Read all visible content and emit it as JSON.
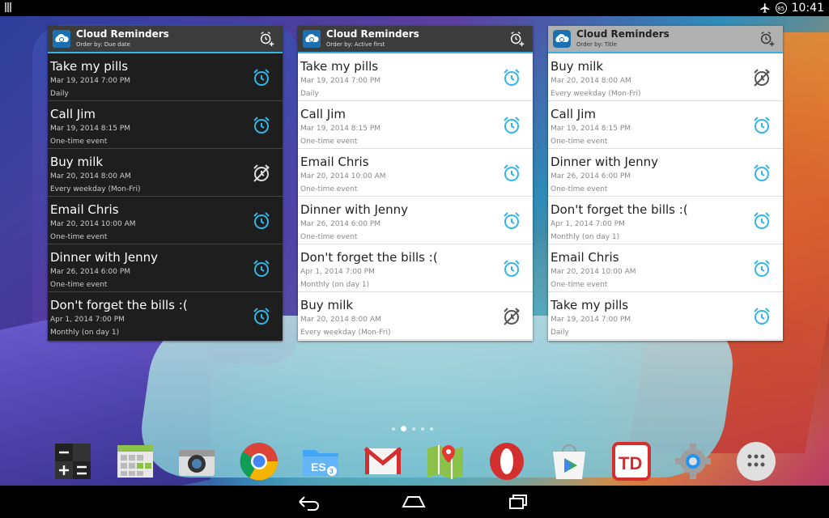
{
  "status_bar": {
    "time": "10:41",
    "battery": "85"
  },
  "widgets": [
    {
      "title": "Cloud Reminders",
      "order": "Order by: Due date",
      "items": [
        {
          "title": "Take my pills",
          "date": "Mar 19, 2014 7:00 PM",
          "repeat": "Daily",
          "alarm": "on"
        },
        {
          "title": "Call Jim",
          "date": "Mar 19, 2014 8:15 PM",
          "repeat": "One-time event",
          "alarm": "on"
        },
        {
          "title": "Buy milk",
          "date": "Mar 20, 2014 8:00 AM",
          "repeat": "Every weekday (Mon-Fri)",
          "alarm": "off"
        },
        {
          "title": "Email Chris",
          "date": "Mar 20, 2014 10:00 AM",
          "repeat": "One-time event",
          "alarm": "on"
        },
        {
          "title": "Dinner with Jenny",
          "date": "Mar 26, 2014 6:00 PM",
          "repeat": "One-time event",
          "alarm": "on"
        },
        {
          "title": "Don't forget the bills :(",
          "date": "Apr 1, 2014 7:00 PM",
          "repeat": "Monthly (on day 1)",
          "alarm": "on"
        }
      ]
    },
    {
      "title": "Cloud Reminders",
      "order": "Order by: Active first",
      "items": [
        {
          "title": "Take my pills",
          "date": "Mar 19, 2014 7:00 PM",
          "repeat": "Daily",
          "alarm": "on"
        },
        {
          "title": "Call Jim",
          "date": "Mar 19, 2014 8:15 PM",
          "repeat": "One-time event",
          "alarm": "on"
        },
        {
          "title": "Email Chris",
          "date": "Mar 20, 2014 10:00 AM",
          "repeat": "One-time event",
          "alarm": "on"
        },
        {
          "title": "Dinner with Jenny",
          "date": "Mar 26, 2014 6:00 PM",
          "repeat": "One-time event",
          "alarm": "on"
        },
        {
          "title": "Don't forget the bills :(",
          "date": "Apr 1, 2014 7:00 PM",
          "repeat": "Monthly (on day 1)",
          "alarm": "on"
        },
        {
          "title": "Buy milk",
          "date": "Mar 20, 2014 8:00 AM",
          "repeat": "Every weekday (Mon-Fri)",
          "alarm": "off"
        }
      ]
    },
    {
      "title": "Cloud Reminders",
      "order": "Order by: Title",
      "items": [
        {
          "title": "Buy milk",
          "date": "Mar 20, 2014 8:00 AM",
          "repeat": "Every weekday (Mon-Fri)",
          "alarm": "off"
        },
        {
          "title": "Call Jim",
          "date": "Mar 19, 2014 8:15 PM",
          "repeat": "One-time event",
          "alarm": "on"
        },
        {
          "title": "Dinner with Jenny",
          "date": "Mar 26, 2014 6:00 PM",
          "repeat": "One-time event",
          "alarm": "on"
        },
        {
          "title": "Don't forget the bills :(",
          "date": "Apr 1, 2014 7:00 PM",
          "repeat": "Monthly (on day 1)",
          "alarm": "on"
        },
        {
          "title": "Email Chris",
          "date": "Mar 20, 2014 10:00 AM",
          "repeat": "One-time event",
          "alarm": "on"
        },
        {
          "title": "Take my pills",
          "date": "Mar 19, 2014 7:00 PM",
          "repeat": "Daily",
          "alarm": "on"
        }
      ]
    }
  ],
  "pager": {
    "pages": 5,
    "active": 1
  },
  "dock": [
    {
      "icon": "calculator-icon"
    },
    {
      "icon": "calendar-icon"
    },
    {
      "icon": "camera-icon"
    },
    {
      "icon": "chrome-icon"
    },
    {
      "icon": "es-file-explorer-icon",
      "badge": "ES3"
    },
    {
      "icon": "gmail-icon"
    },
    {
      "icon": "maps-icon"
    },
    {
      "icon": "opera-icon"
    },
    {
      "icon": "play-store-icon"
    },
    {
      "icon": "todoist-icon"
    },
    {
      "icon": "settings-icon"
    },
    {
      "icon": "app-drawer-icon"
    }
  ],
  "nav": {
    "back": "back-icon",
    "home": "home-icon",
    "recents": "recents-icon"
  },
  "colors": {
    "accent": "#33b5e5",
    "alarm_on": "#33b5e5",
    "alarm_off_dark": "#dddddd",
    "alarm_off_light": "#555555"
  }
}
